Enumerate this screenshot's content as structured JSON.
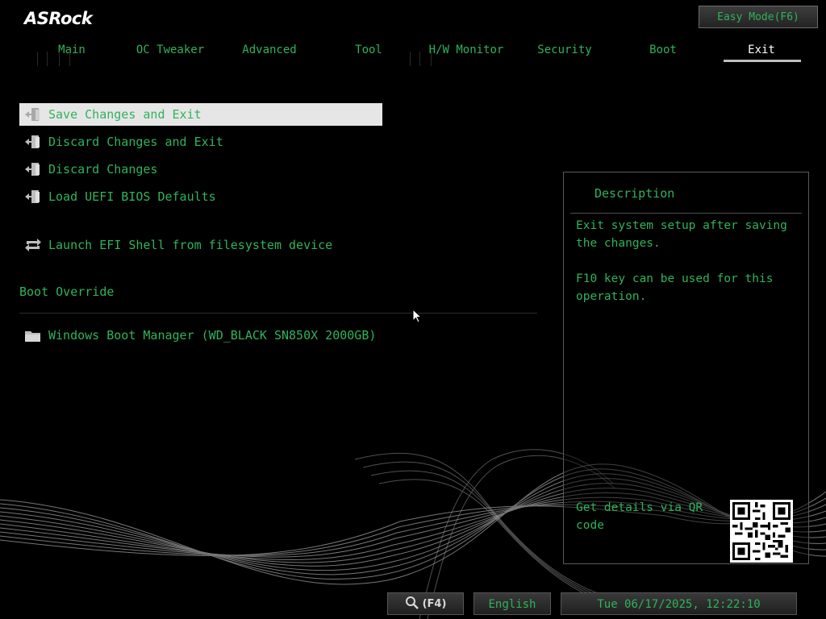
{
  "header": {
    "logo": "ASRock",
    "easy_mode_label": "Easy Mode(F6)"
  },
  "tabs": [
    {
      "label": "Main"
    },
    {
      "label": "OC Tweaker"
    },
    {
      "label": "Advanced"
    },
    {
      "label": "Tool"
    },
    {
      "label": "H/W Monitor"
    },
    {
      "label": "Security"
    },
    {
      "label": "Boot"
    },
    {
      "label": "Exit",
      "active": true
    }
  ],
  "menu": {
    "items": [
      {
        "label": "Save Changes and Exit",
        "icon": "exit-door-icon",
        "selected": true
      },
      {
        "label": "Discard Changes and Exit",
        "icon": "exit-door-icon"
      },
      {
        "label": "Discard Changes",
        "icon": "exit-door-icon"
      },
      {
        "label": "Load UEFI BIOS Defaults",
        "icon": "exit-door-icon"
      },
      {
        "label": "Launch EFI Shell from filesystem device",
        "icon": "refresh-arrows-icon"
      }
    ],
    "boot_override_title": "Boot Override",
    "boot_items": [
      {
        "label": "Windows Boot Manager (WD_BLACK SN850X 2000GB)",
        "icon": "folder-icon"
      }
    ]
  },
  "description": {
    "title": "Description",
    "body": "Exit system setup after saving the changes.\n\nF10 key can be used for this operation.",
    "qr_text": "Get details via QR code",
    "qr_icon": "qr-code-icon"
  },
  "status_bar": {
    "search_label": "(F4)",
    "search_icon": "magnifier-icon",
    "language": "English",
    "datetime": "Tue 06/17/2025, 12:22:10"
  },
  "colors": {
    "accent": "#2fb35a",
    "selected_bg": "#e6e6e6",
    "active_tab": "#ffffff"
  }
}
